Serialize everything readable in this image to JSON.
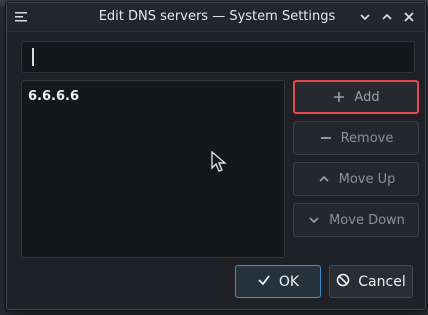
{
  "window": {
    "title": "Edit DNS servers — System Settings",
    "buttons": {
      "minimize": "minimize-icon",
      "maximize": "maximize-icon",
      "close": "close-icon"
    }
  },
  "input": {
    "value": ""
  },
  "servers": [
    "6.6.6.6"
  ],
  "actions": {
    "add": "Add",
    "remove": "Remove",
    "move_up": "Move Up",
    "move_down": "Move Down"
  },
  "footer": {
    "ok": "OK",
    "cancel": "Cancel"
  },
  "accent": "#3b8fd0",
  "focus_border": "#e5484d"
}
